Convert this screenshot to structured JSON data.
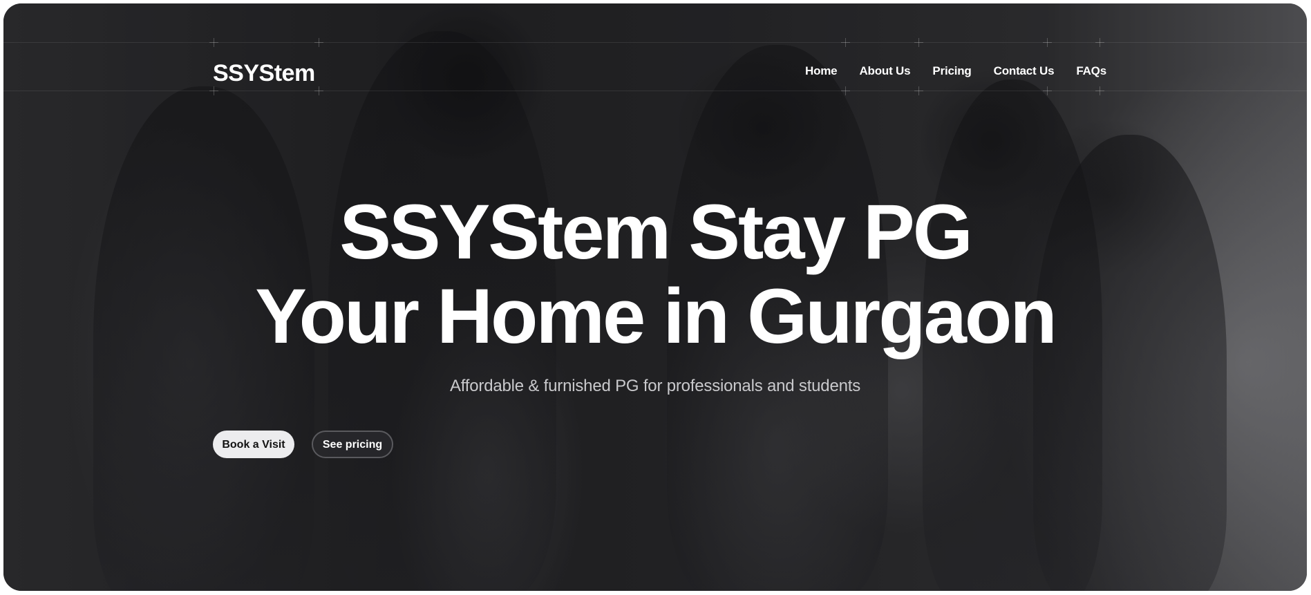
{
  "header": {
    "logo": "SSYStem",
    "nav": [
      {
        "label": "Home"
      },
      {
        "label": "About Us"
      },
      {
        "label": "Pricing"
      },
      {
        "label": "Contact Us"
      },
      {
        "label": "FAQs"
      }
    ]
  },
  "hero": {
    "title_line1": "SSYStem Stay PG",
    "title_line2": "Your Home in Gurgaon",
    "subtitle": "Affordable & furnished PG for professionals and students",
    "primary_button": "Book a Visit",
    "secondary_button": "See pricing"
  },
  "colors": {
    "text": "#ffffff",
    "subtitle": "#c9c9cc",
    "primary_button_bg": "#ececee",
    "secondary_button_bg": "#28282b"
  }
}
